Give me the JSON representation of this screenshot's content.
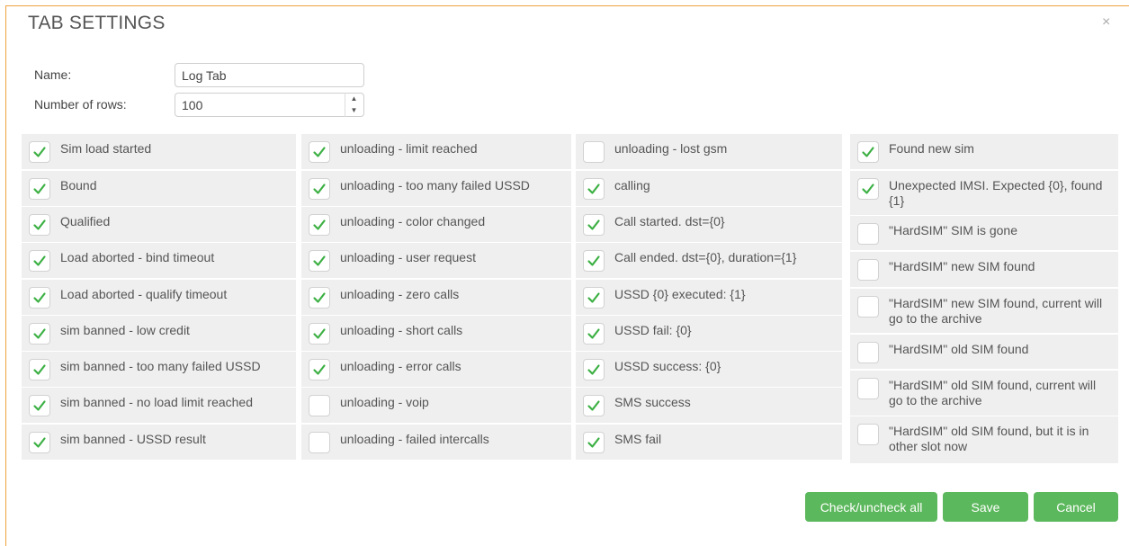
{
  "dialog": {
    "title": "TAB SETTINGS",
    "close_symbol": "×"
  },
  "form": {
    "name_label": "Name:",
    "name_value": "Log Tab",
    "rows_label": "Number of rows:",
    "rows_value": "100"
  },
  "columns": [
    [
      {
        "label": "Sim load started",
        "checked": true
      },
      {
        "label": "Bound",
        "checked": true
      },
      {
        "label": "Qualified",
        "checked": true
      },
      {
        "label": "Load aborted - bind timeout",
        "checked": true
      },
      {
        "label": "Load aborted - qualify timeout",
        "checked": true
      },
      {
        "label": "sim banned - low credit",
        "checked": true
      },
      {
        "label": "sim banned - too many failed USSD",
        "checked": true
      },
      {
        "label": "sim banned - no load limit reached",
        "checked": true
      },
      {
        "label": "sim banned - USSD result",
        "checked": true
      }
    ],
    [
      {
        "label": "unloading - limit reached",
        "checked": true
      },
      {
        "label": "unloading - too many failed USSD",
        "checked": true
      },
      {
        "label": "unloading - color changed",
        "checked": true
      },
      {
        "label": "unloading - user request",
        "checked": true
      },
      {
        "label": "unloading - zero calls",
        "checked": true
      },
      {
        "label": "unloading - short calls",
        "checked": true
      },
      {
        "label": "unloading - error calls",
        "checked": true
      },
      {
        "label": "unloading - voip",
        "checked": false
      },
      {
        "label": "unloading - failed intercalls",
        "checked": false
      }
    ],
    [
      {
        "label": "unloading - lost gsm",
        "checked": false
      },
      {
        "label": "calling",
        "checked": true
      },
      {
        "label": "Call started. dst={0}",
        "checked": true
      },
      {
        "label": "Call ended. dst={0}, duration={1}",
        "checked": true
      },
      {
        "label": "USSD {0} executed: {1}",
        "checked": true
      },
      {
        "label": "USSD fail: {0}",
        "checked": true
      },
      {
        "label": "USSD success: {0}",
        "checked": true
      },
      {
        "label": "SMS success",
        "checked": true
      },
      {
        "label": "SMS fail",
        "checked": true
      }
    ],
    [
      {
        "label": "Found new sim",
        "checked": true
      },
      {
        "label": "Unexpected IMSI. Expected {0}, found {1}",
        "checked": true
      },
      {
        "label": "\"HardSIM\" SIM is gone",
        "checked": false
      },
      {
        "label": "\"HardSIM\" new SIM found",
        "checked": false
      },
      {
        "label": "\"HardSIM\" new SIM found, current will go to the archive",
        "checked": false
      },
      {
        "label": "\"HardSIM\" old SIM found",
        "checked": false
      },
      {
        "label": "\"HardSIM\" old SIM found, current will go to the archive",
        "checked": false
      },
      {
        "label": "\"HardSIM\" old SIM found, but it is in other slot now",
        "checked": false
      }
    ]
  ],
  "buttons": {
    "check_all": "Check/uncheck all",
    "save": "Save",
    "cancel": "Cancel"
  },
  "colors": {
    "accent_green": "#5cb85c",
    "check_green": "#3cb043",
    "frame_orange": "#f0a040"
  }
}
